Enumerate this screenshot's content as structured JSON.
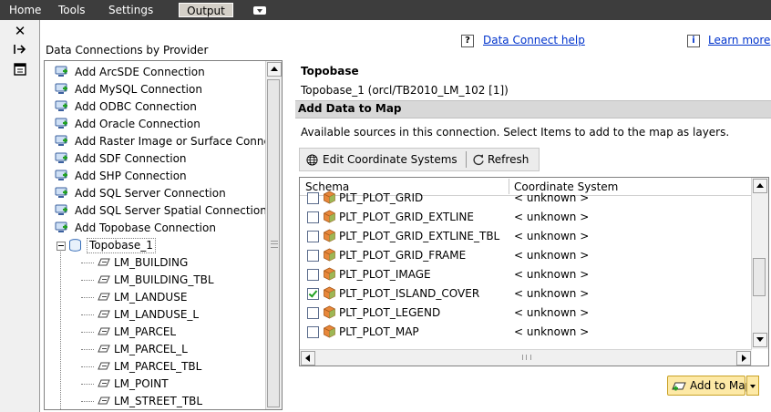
{
  "menubar": {
    "items": [
      "Home",
      "Tools",
      "Settings"
    ],
    "active_tab": "Output"
  },
  "panel": {
    "title": "Data Connections by Provider",
    "help_link": "Data Connect help",
    "learn_link": "Learn more"
  },
  "tree": {
    "providers": [
      "Add ArcSDE Connection",
      "Add MySQL Connection",
      "Add ODBC Connection",
      "Add Oracle Connection",
      "Add Raster Image or Surface Conne",
      "Add SDF Connection",
      "Add SHP Connection",
      "Add SQL Server Connection",
      "Add SQL Server Spatial Connection",
      "Add Topobase Connection"
    ],
    "connection": {
      "name": "Topobase_1",
      "layers": [
        "LM_BUILDING",
        "LM_BUILDING_TBL",
        "LM_LANDUSE",
        "LM_LANDUSE_L",
        "LM_PARCEL",
        "LM_PARCEL_L",
        "LM_PARCEL_TBL",
        "LM_POINT",
        "LM_STREET_TBL"
      ]
    }
  },
  "source": {
    "title": "Topobase",
    "subtitle": "Topobase_1 (orcl/TB2010_LM_102 [1])"
  },
  "add_data": {
    "section_title": "Add Data to Map",
    "description": "Available sources in this connection.  Select Items to add to the map as layers.",
    "edit_cs_label": "Edit Coordinate Systems",
    "refresh_label": "Refresh",
    "columns": {
      "schema": "Schema",
      "coordinate_system": "Coordinate System"
    },
    "rows": [
      {
        "schema": "PLT_PLOT_GRID",
        "cs": "< unknown >",
        "checked": false
      },
      {
        "schema": "PLT_PLOT_GRID_EXTLINE",
        "cs": "< unknown >",
        "checked": false
      },
      {
        "schema": "PLT_PLOT_GRID_EXTLINE_TBL",
        "cs": "< unknown >",
        "checked": false
      },
      {
        "schema": "PLT_PLOT_GRID_FRAME",
        "cs": "< unknown >",
        "checked": false
      },
      {
        "schema": "PLT_PLOT_IMAGE",
        "cs": "< unknown >",
        "checked": false
      },
      {
        "schema": "PLT_PLOT_ISLAND_COVER",
        "cs": "< unknown >",
        "checked": true
      },
      {
        "schema": "PLT_PLOT_LEGEND",
        "cs": "< unknown >",
        "checked": false
      },
      {
        "schema": "PLT_PLOT_MAP",
        "cs": "< unknown >",
        "checked": false
      }
    ],
    "add_to_map_label": "Add to Map"
  },
  "colors": {
    "menubar_bg": "#3d3d3d",
    "link": "#0033cc",
    "section_bar": "#d8d8d8",
    "cube_orange": "#e8873a",
    "check_green": "#21a121",
    "add_button_bg": "#fde9a6"
  }
}
